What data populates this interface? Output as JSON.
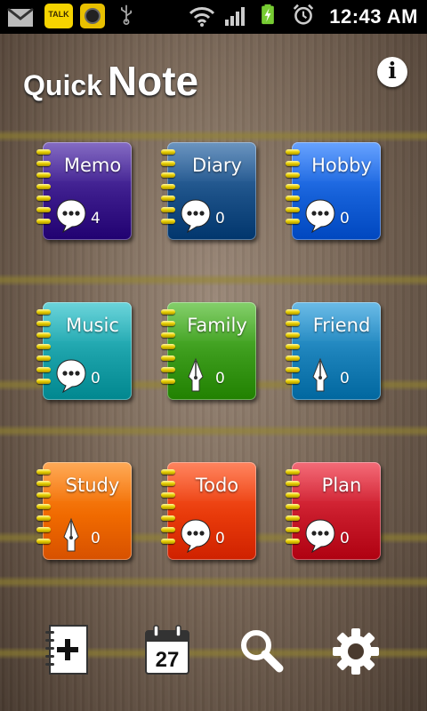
{
  "status_bar": {
    "time": "12:43 AM",
    "left_icons": [
      "gmail-icon",
      "kakaotalk-icon",
      "camera-app-icon",
      "usb-icon"
    ],
    "right_icons": [
      "wifi-icon",
      "signal-icon",
      "battery-charging-icon",
      "alarm-icon"
    ],
    "talk_badge": "TALK"
  },
  "header": {
    "title_word1": "Quick",
    "title_word2": "Note",
    "info_label": "i"
  },
  "notebooks": [
    {
      "label": "Memo",
      "count": "4",
      "icon": "speech-bubble-icon",
      "color": "#3a1a8a"
    },
    {
      "label": "Diary",
      "count": "0",
      "icon": "speech-bubble-icon",
      "color": "#1a4f86"
    },
    {
      "label": "Hobby",
      "count": "0",
      "icon": "speech-bubble-icon",
      "color": "#1560d8"
    },
    {
      "label": "Music",
      "count": "0",
      "icon": "speech-bubble-icon",
      "color": "#1aa0a8"
    },
    {
      "label": "Family",
      "count": "0",
      "icon": "fountain-pen-icon",
      "color": "#3a9a1a"
    },
    {
      "label": "Friend",
      "count": "0",
      "icon": "fountain-pen-icon",
      "color": "#1a80b8"
    },
    {
      "label": "Study",
      "count": "0",
      "icon": "fountain-pen-icon",
      "color": "#f06a00"
    },
    {
      "label": "Todo",
      "count": "0",
      "icon": "speech-bubble-icon",
      "color": "#e83a0a"
    },
    {
      "label": "Plan",
      "count": "0",
      "icon": "speech-bubble-icon",
      "color": "#c81a2a"
    }
  ],
  "bottom_bar": {
    "buttons": [
      "add-note-icon",
      "calendar-icon",
      "search-icon",
      "settings-gear-icon"
    ],
    "calendar_day": "27"
  }
}
